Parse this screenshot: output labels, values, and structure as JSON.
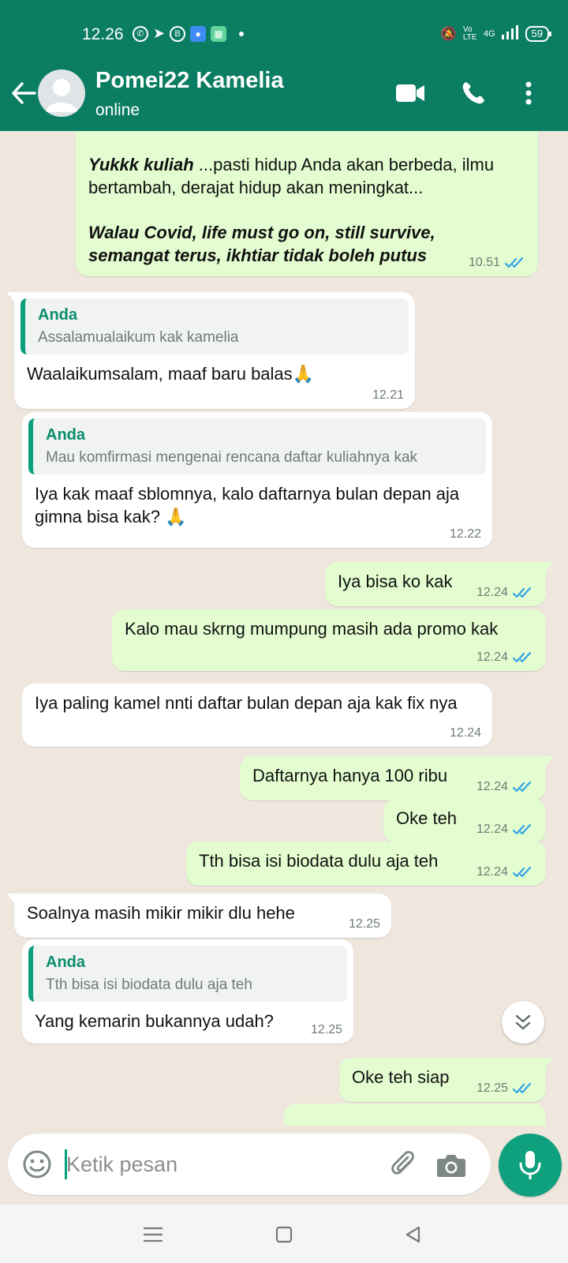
{
  "status_bar": {
    "time": "12.26",
    "volte": "Vo LTE",
    "network": "4G",
    "battery": "59"
  },
  "header": {
    "contact_name": "Pomei22 Kamelia",
    "status": "online",
    "icons": [
      "back-arrow-icon",
      "avatar",
      "video-call-icon",
      "phone-call-icon",
      "more-vert-icon"
    ],
    "color": "#0b7d62"
  },
  "messages": [
    {
      "id": "m1",
      "direction": "out",
      "bold_italic_1": "Yukkk kuliah",
      "text_1": " ...pasti hidup Anda akan berbeda, ilmu bertambah, derajat hidup akan meningkat...",
      "bold_italic_2": "Walau Covid, life must go on, still survive, semangat terus, ikhtiar tidak boleh putus",
      "time": "10.51",
      "read": true
    },
    {
      "id": "m2",
      "direction": "in",
      "quote_author": "Anda",
      "quote_text": "Assalamualaikum kak kamelia",
      "text": "Waalaikumsalam, maaf baru balas",
      "emoji": "🙏",
      "time": "12.21"
    },
    {
      "id": "m3",
      "direction": "in",
      "quote_author": "Anda",
      "quote_text": "Mau komfirmasi mengenai rencana daftar kuliahnya kak",
      "text": "Iya kak maaf sblomnya, kalo daftarnya bulan depan aja gimna bisa kak?",
      "emoji": "🙏",
      "time": "12.22"
    },
    {
      "id": "m4",
      "direction": "out",
      "text": "Iya bisa ko kak",
      "time": "12.24",
      "read": true
    },
    {
      "id": "m5",
      "direction": "out",
      "text": "Kalo mau skrng mumpung masih ada promo kak",
      "time": "12.24",
      "read": true
    },
    {
      "id": "m6",
      "direction": "in",
      "text": "Iya paling kamel nnti daftar bulan depan aja kak fix nya",
      "time": "12.24"
    },
    {
      "id": "m7",
      "direction": "out",
      "text": "Daftarnya hanya 100 ribu",
      "time": "12.24",
      "read": true
    },
    {
      "id": "m8",
      "direction": "out",
      "text": "Oke teh",
      "time": "12.24",
      "read": true
    },
    {
      "id": "m9",
      "direction": "out",
      "text": "Tth bisa isi biodata dulu aja teh",
      "time": "12.24",
      "read": true
    },
    {
      "id": "m10",
      "direction": "in",
      "text": "Soalnya masih mikir mikir dlu hehe",
      "time": "12.25"
    },
    {
      "id": "m11",
      "direction": "in",
      "quote_author": "Anda",
      "quote_text": "Tth bisa isi biodata dulu aja teh",
      "text": "Yang kemarin bukannya udah?",
      "time": "12.25"
    },
    {
      "id": "m12",
      "direction": "out",
      "text": "Oke teh siap",
      "time": "12.25",
      "read": true
    }
  ],
  "composer": {
    "placeholder": "Ketik pesan",
    "icons": [
      "emoji-icon",
      "attach-icon",
      "camera-icon",
      "mic-icon"
    ]
  },
  "colors": {
    "accent": "#0fa07d",
    "outgoing_bubble": "#e3fdd0",
    "incoming_bubble": "#ffffff",
    "chat_background": "#efe7de",
    "read_ticks": "#34a3e6"
  }
}
